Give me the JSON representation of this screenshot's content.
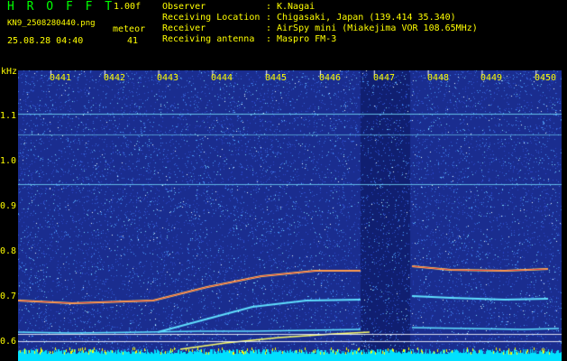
{
  "header": {
    "brand": "H R O F F T",
    "version": "1.00f",
    "filename": "KN9_2508280440.png",
    "station": "meteor",
    "datetime": "25.08.28 04:40",
    "count": "41",
    "info": [
      {
        "label": "Observer",
        "value": "K.Nagai"
      },
      {
        "label": "Receiving Location",
        "value": "Chigasaki, Japan (139.414 35.340)"
      },
      {
        "label": "Receiver",
        "value": "AirSpy mini (Miakejima VOR 108.65MHz)"
      },
      {
        "label": "Receiving antenna",
        "value": "Maspro FM-3"
      }
    ]
  },
  "spectrogram": {
    "unit": "kHz",
    "y_ticks": [
      "1.1",
      "1.0",
      "0.9",
      "0.8",
      "0.7",
      "0.6"
    ],
    "time_ticks": [
      "0441",
      "0442",
      "0443",
      "0444",
      "0445",
      "0446",
      "0447",
      "0448",
      "0449",
      "0450"
    ],
    "colors": {
      "background": "#1a2d8f",
      "trace_hot": "#ff3a3a",
      "trace_warm": "#ffff66",
      "trace_cool": "#60e0ff",
      "baseline": "#00e0ff"
    }
  }
}
